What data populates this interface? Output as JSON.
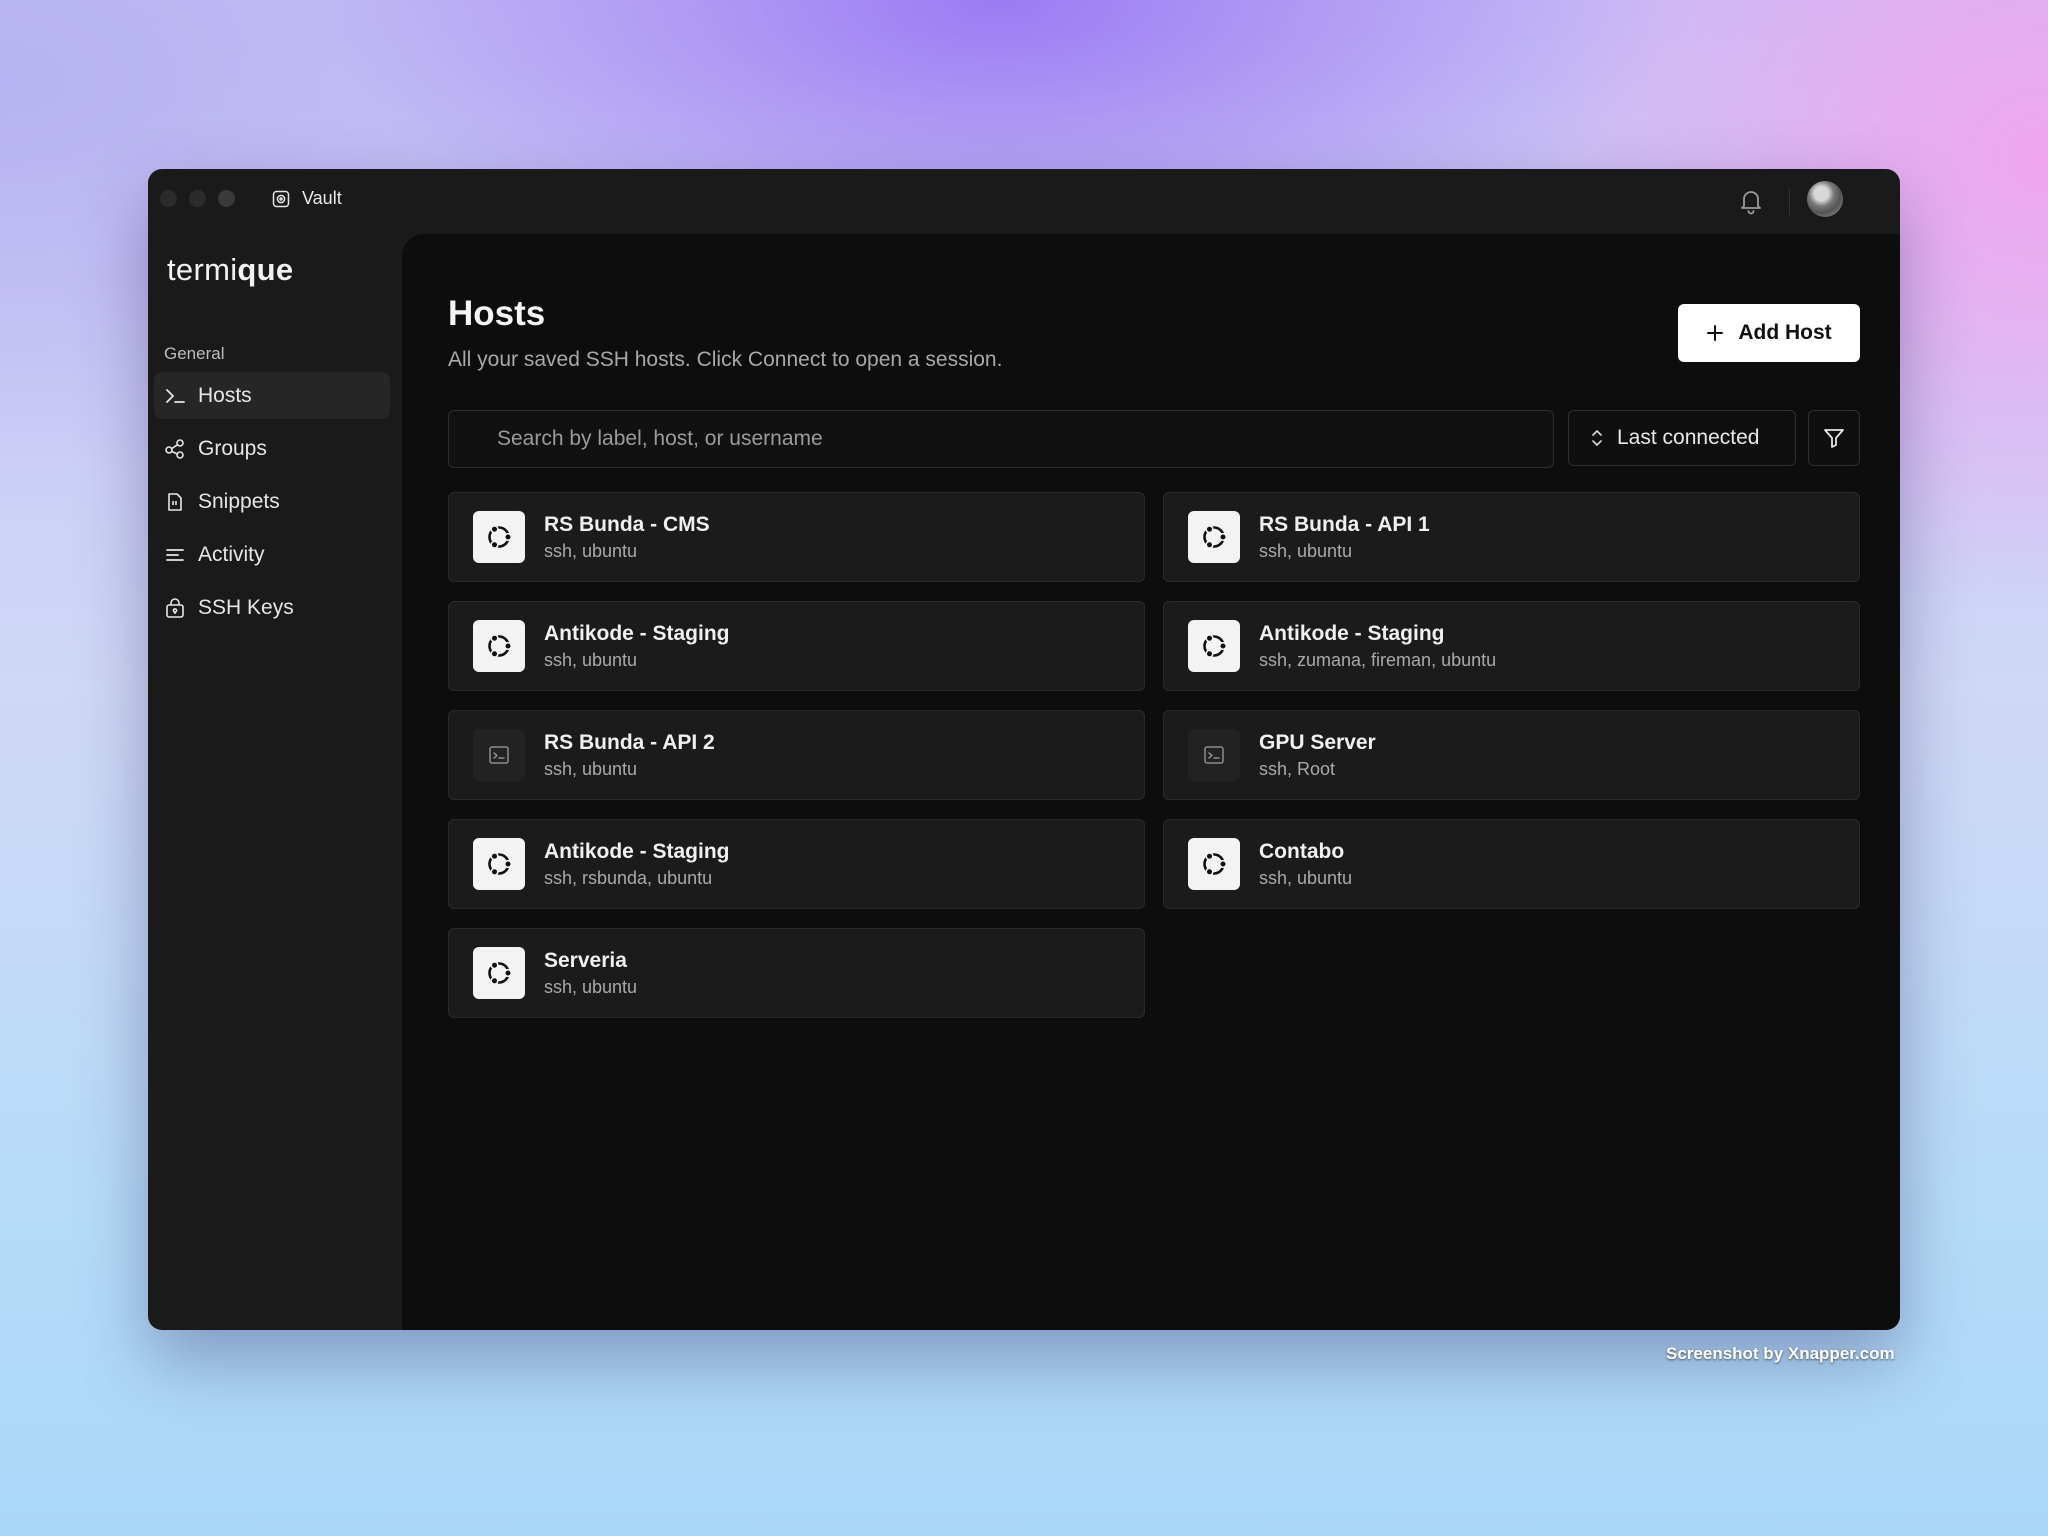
{
  "window": {
    "title": "Vault"
  },
  "app": {
    "logo_regular": "termi",
    "logo_bold": "que"
  },
  "sidebar": {
    "section": "General",
    "items": [
      {
        "label": "Hosts",
        "icon": "terminal-prompt-icon",
        "active": true
      },
      {
        "label": "Groups",
        "icon": "groups-icon",
        "active": false
      },
      {
        "label": "Snippets",
        "icon": "snippets-icon",
        "active": false
      },
      {
        "label": "Activity",
        "icon": "activity-icon",
        "active": false
      },
      {
        "label": "SSH Keys",
        "icon": "key-lock-icon",
        "active": false
      }
    ]
  },
  "page": {
    "title": "Hosts",
    "subtitle": "All your saved SSH hosts. Click Connect to open a session.",
    "add_button": "Add Host"
  },
  "search": {
    "placeholder": "Search by label, host, or username"
  },
  "sort": {
    "label": "Last connected"
  },
  "hosts": [
    {
      "name": "RS Bunda - CMS",
      "meta": "ssh, ubuntu",
      "icon": "ubuntu-icon"
    },
    {
      "name": "RS Bunda - API 1",
      "meta": "ssh, ubuntu",
      "icon": "ubuntu-icon"
    },
    {
      "name": "Antikode - Staging",
      "meta": "ssh, ubuntu",
      "icon": "ubuntu-icon"
    },
    {
      "name": "Antikode - Staging",
      "meta": "ssh, zumana, fireman, ubuntu",
      "icon": "ubuntu-icon"
    },
    {
      "name": "RS Bunda - API 2",
      "meta": "ssh, ubuntu",
      "icon": "terminal-icon"
    },
    {
      "name": "GPU Server",
      "meta": "ssh, Root",
      "icon": "terminal-icon"
    },
    {
      "name": "Antikode - Staging",
      "meta": "ssh, rsbunda, ubuntu",
      "icon": "ubuntu-icon"
    },
    {
      "name": "Contabo",
      "meta": "ssh, ubuntu",
      "icon": "ubuntu-icon"
    },
    {
      "name": "Serveria",
      "meta": "ssh, ubuntu",
      "icon": "ubuntu-icon"
    }
  ],
  "footer": {
    "credit": "Screenshot by Xnapper.com"
  }
}
